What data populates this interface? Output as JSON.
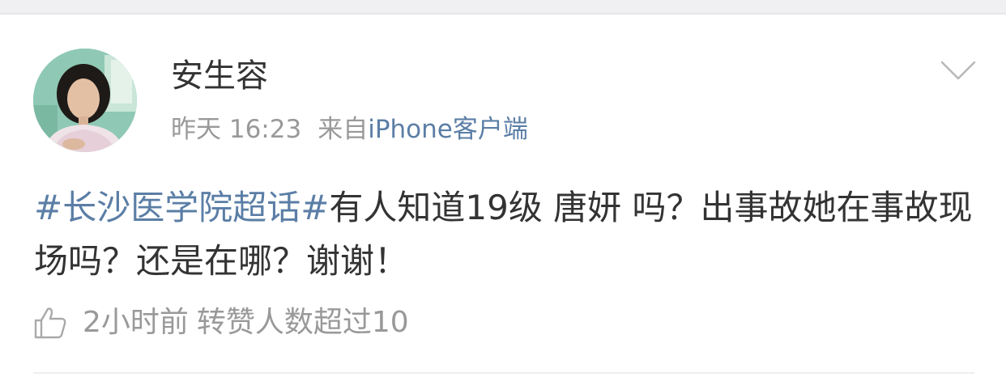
{
  "post": {
    "author": {
      "name": "安生容",
      "avatar_icon": "user-avatar-photo"
    },
    "meta": {
      "time": "昨天 16:23",
      "source_prefix": "来自",
      "source": "iPhone客户端"
    },
    "content": {
      "topic": "#长沙医学院超话#",
      "text": "有人知道19级 唐妍 吗？出事故她在事故现场吗？还是在哪？谢谢！"
    },
    "footer": {
      "like_icon": "thumbs-up-icon",
      "time_ago": "2小时前",
      "repost_info": "转赞人数超过10"
    },
    "menu_icon": "chevron-down-icon"
  },
  "colors": {
    "topic_link": "#5b7ea6",
    "text": "#333333",
    "secondary": "#999999"
  }
}
